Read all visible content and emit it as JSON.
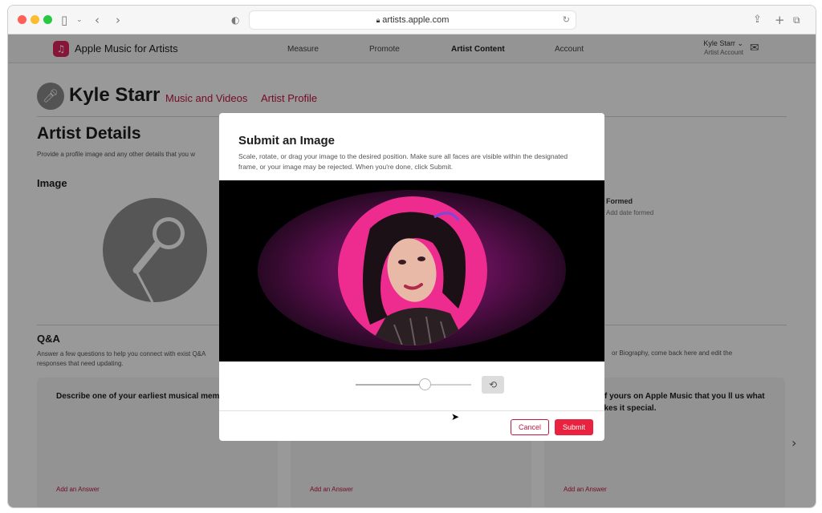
{
  "browser": {
    "url": "artists.apple.com",
    "icons": [
      "sidebar-icon",
      "back-icon",
      "forward-icon",
      "privacy-shield-icon",
      "lock-icon",
      "reload-icon",
      "share-icon",
      "new-tab-icon",
      "tabs-overview-icon"
    ]
  },
  "nav": {
    "app_name": "Apple Music for Artists",
    "links": [
      "Measure",
      "Promote",
      "Artist Content",
      "Account"
    ],
    "active_link": "Artist Content",
    "user_name": "Kyle Starr",
    "user_role": "Artist Account"
  },
  "artist": {
    "name": "Kyle Starr",
    "tabs": [
      "Music and Videos",
      "Artist Profile"
    ]
  },
  "details": {
    "title": "Artist Details",
    "description": "Provide a profile image and any other details that you w",
    "image_heading": "Image",
    "formed_label": "Formed",
    "formed_placeholder": "Add date formed"
  },
  "qa": {
    "heading": "Q&A",
    "description": "Answer a few questions to help you connect with exist Q&A responses that need updating.",
    "description_right": "or Biography, come back here and edit the",
    "cards": [
      {
        "question": "Describe one of your earliest musical mem in detail.",
        "add_label": "Add an Answer"
      },
      {
        "question": "",
        "add_label": "Add an Answer"
      },
      {
        "question": "g of yours on Apple Music that you ll us what makes it special.",
        "add_label": "Add an Answer"
      }
    ]
  },
  "modal": {
    "title": "Submit an Image",
    "description": "Scale, rotate, or drag your image to the desired position. Make sure all faces are visible within the designated frame, or your image may be rejected. When you're done, click Submit.",
    "zoom_level": 0.6,
    "cancel_label": "Cancel",
    "submit_label": "Submit"
  },
  "colors": {
    "accent": "#c4153f",
    "submit": "#e8223f",
    "crop_circle": "#ee2b8f"
  }
}
